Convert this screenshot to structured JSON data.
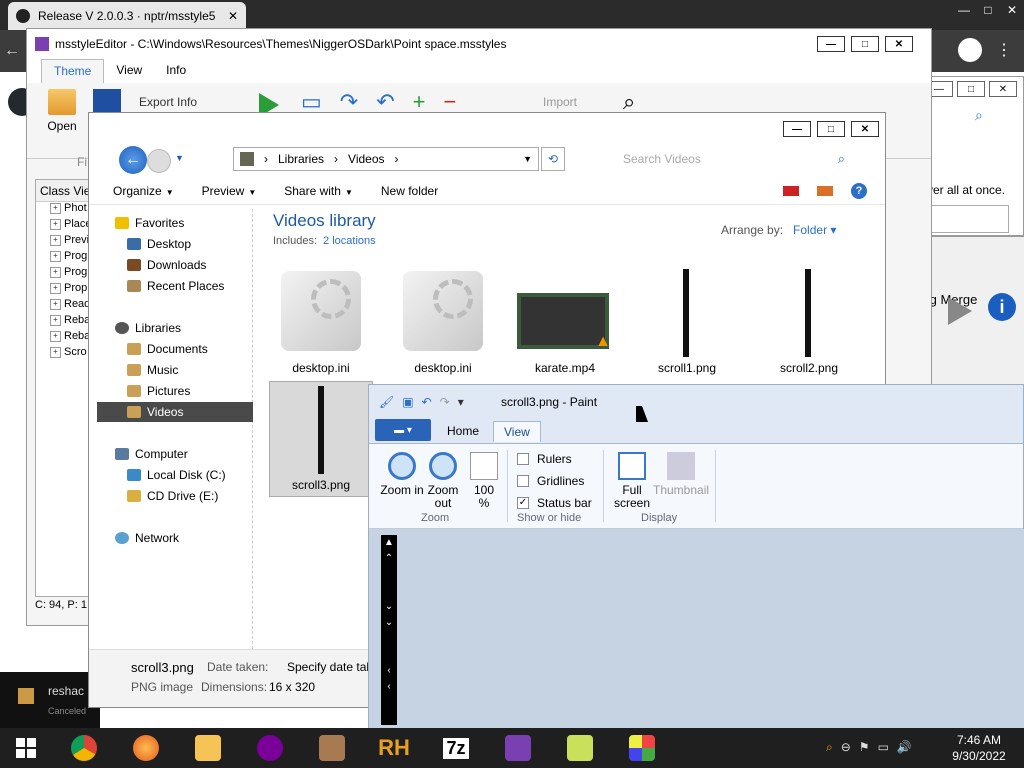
{
  "browser": {
    "tab_title": "Release V 2.0.0.3 · nptr/msstyle5",
    "tab_close": "✕",
    "new_tab": "+",
    "controls": [
      "—",
      "□",
      "✕"
    ]
  },
  "msstyleEditor": {
    "title": "msstyleEditor - C:\\Windows\\Resources\\Themes\\NiggerOSDark\\Point space.msstyles",
    "tabs": [
      "Theme",
      "View",
      "Info"
    ],
    "ribbon": {
      "open": "Open",
      "export_info": "Export Info",
      "import": "Import",
      "file_group": "Fi"
    },
    "class_view_header": "Class View",
    "tree_items": [
      "Phot",
      "Place",
      "Previ",
      "Prog",
      "Prog",
      "Prop",
      "Read",
      "Reba",
      "Reba",
      "Scro"
    ],
    "status": "C: 94, P: 1"
  },
  "right_window": {
    "text": "ver all at once.",
    "dialog_label": "Dialog Merge"
  },
  "explorer": {
    "address": [
      "Libraries",
      "Videos"
    ],
    "search_placeholder": "Search Videos",
    "commands": [
      "Organize",
      "Preview",
      "Share with",
      "New folder"
    ],
    "nav": {
      "favorites": "Favorites",
      "desktop": "Desktop",
      "downloads": "Downloads",
      "recent": "Recent Places",
      "libraries": "Libraries",
      "documents": "Documents",
      "music": "Music",
      "pictures": "Pictures",
      "videos": "Videos",
      "computer": "Computer",
      "local_disk": "Local Disk (C:)",
      "cd_drive": "CD Drive (E:)",
      "network": "Network"
    },
    "library_title": "Videos library",
    "includes_label": "Includes:",
    "includes_link": "2 locations",
    "arrange_label": "Arrange by:",
    "arrange_value": "Folder",
    "files": [
      "desktop.ini",
      "desktop.ini",
      "karate.mp4",
      "scroll1.png",
      "scroll2.png",
      "scroll3.png"
    ],
    "details": {
      "name": "scroll3.png",
      "type": "PNG image",
      "date_label": "Date taken:",
      "date_value": "Specify date taken",
      "dim_label": "Dimensions:",
      "dim_value": "16 x 320"
    }
  },
  "paint": {
    "title": "scroll3.png - Paint",
    "tabs": [
      "Home",
      "View"
    ],
    "zoom_in": "Zoom in",
    "zoom_out": "Zoom out",
    "hundred": "100 %",
    "zoom_group": "Zoom",
    "rulers": "Rulers",
    "gridlines": "Gridlines",
    "status_bar": "Status bar",
    "show_hide_group": "Show or hide",
    "full_screen": "Full screen",
    "thumbnail": "Thumbnail",
    "display_group": "Display",
    "checks": {
      "rulers": false,
      "gridlines": false,
      "status_bar": true
    }
  },
  "reshack": {
    "name": "reshac",
    "status": "Canceled"
  },
  "taskbar": {
    "time": "7:46 AM",
    "date": "9/30/2022",
    "rh_label": "RH",
    "sevenzip_label": "7z"
  }
}
